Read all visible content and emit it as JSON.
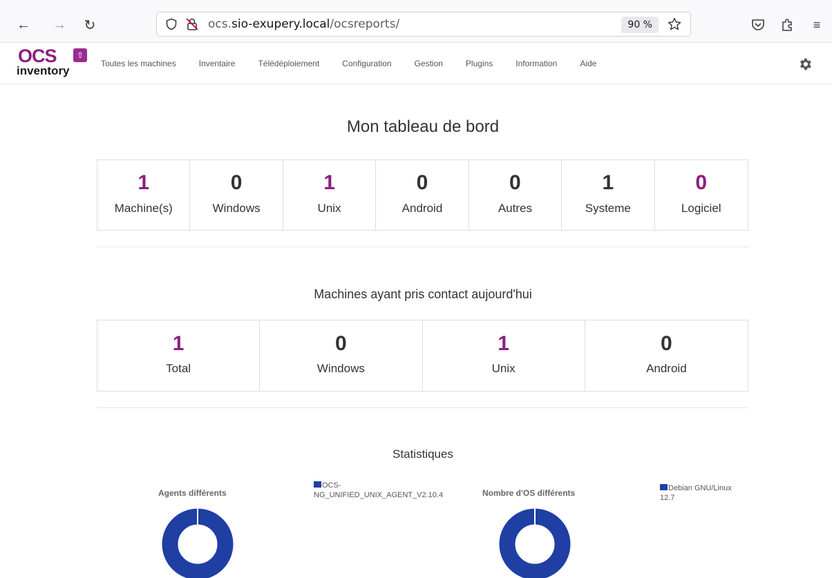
{
  "browser": {
    "url_prefix": "ocs.",
    "url_host": "sio-exupery.local",
    "url_path": "/ocsreports/",
    "zoom": "90 %"
  },
  "app": {
    "logo_top": "OCS",
    "logo_bottom": "inventory",
    "menu": [
      "Toutes les machines",
      "Inventaire",
      "Télédéploiement",
      "Configuration",
      "Gestion",
      "Plugins",
      "Information",
      "Aide"
    ]
  },
  "dashboard": {
    "title": "Mon tableau de bord",
    "stats": [
      {
        "value": "1",
        "label": "Machine(s)"
      },
      {
        "value": "0",
        "label": "Windows"
      },
      {
        "value": "1",
        "label": "Unix"
      },
      {
        "value": "0",
        "label": "Android"
      },
      {
        "value": "0",
        "label": "Autres"
      },
      {
        "value": "1",
        "label": "Systeme"
      },
      {
        "value": "0",
        "label": "Logiciel"
      }
    ]
  },
  "today": {
    "title": "Machines ayant pris contact aujourd'hui",
    "stats": [
      {
        "value": "1",
        "label": "Total"
      },
      {
        "value": "0",
        "label": "Windows"
      },
      {
        "value": "1",
        "label": "Unix"
      },
      {
        "value": "0",
        "label": "Android"
      }
    ]
  },
  "statistics": {
    "title": "Statistiques",
    "charts": [
      {
        "title": "Agents différents",
        "legend": [
          "OCS-",
          "NG_UNIFIED_UNIX_AGENT_V2.10.4"
        ]
      },
      {
        "title": "Nombre d'OS différents",
        "legend": [
          "Debian GNU/Linux",
          "12.7"
        ]
      }
    ]
  },
  "colors": {
    "accent": "#8b1e80",
    "chart": "#1f3fa3"
  }
}
